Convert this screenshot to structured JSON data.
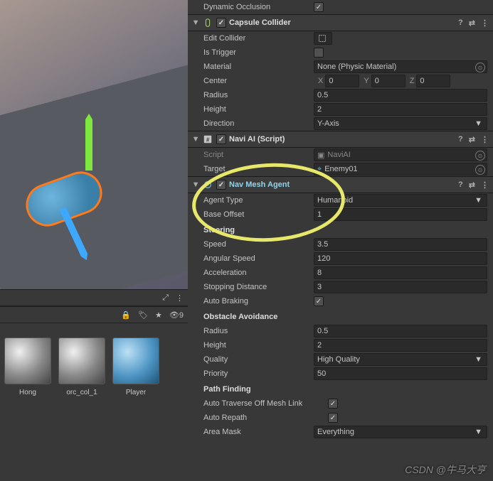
{
  "viewport": {
    "materials": [
      {
        "label": "Hong",
        "variant": "grey"
      },
      {
        "label": "orc_col_1",
        "variant": "grey"
      },
      {
        "label": "Player",
        "variant": "blue"
      }
    ],
    "visibility_count": "9"
  },
  "inspector": {
    "dyn_occlusion": {
      "label": "Dynamic Occlusion"
    },
    "capsule_collider": {
      "title": "Capsule Collider",
      "edit_collider": "Edit Collider",
      "is_trigger": "Is Trigger",
      "material": {
        "label": "Material",
        "value": "None (Physic Material)"
      },
      "center": {
        "label": "Center",
        "x": "0",
        "y": "0",
        "z": "0"
      },
      "radius": {
        "label": "Radius",
        "value": "0.5"
      },
      "height": {
        "label": "Height",
        "value": "2"
      },
      "direction": {
        "label": "Direction",
        "value": "Y-Axis"
      }
    },
    "navi_ai": {
      "title": "Navi AI (Script)",
      "script": {
        "label": "Script",
        "value": "NaviAI"
      },
      "target": {
        "label": "Target",
        "value": "Enemy01"
      }
    },
    "nav_mesh_agent": {
      "title": "Nav Mesh Agent",
      "agent_type": {
        "label": "Agent Type",
        "value": "Humanoid"
      },
      "base_offset": {
        "label": "Base Offset",
        "value": "1"
      },
      "steering": {
        "header": "Steering",
        "speed": {
          "label": "Speed",
          "value": "3.5"
        },
        "angular_speed": {
          "label": "Angular Speed",
          "value": "120"
        },
        "acceleration": {
          "label": "Acceleration",
          "value": "8"
        },
        "stopping_distance": {
          "label": "Stopping Distance",
          "value": "3"
        },
        "auto_braking": {
          "label": "Auto Braking"
        }
      },
      "obstacle": {
        "header": "Obstacle Avoidance",
        "radius": {
          "label": "Radius",
          "value": "0.5"
        },
        "height": {
          "label": "Height",
          "value": "2"
        },
        "quality": {
          "label": "Quality",
          "value": "High Quality"
        },
        "priority": {
          "label": "Priority",
          "value": "50"
        }
      },
      "pathfinding": {
        "header": "Path Finding",
        "traverse": {
          "label": "Auto Traverse Off Mesh Link"
        },
        "repath": {
          "label": "Auto Repath"
        },
        "area_mask": {
          "label": "Area Mask",
          "value": "Everything"
        }
      }
    }
  },
  "watermark": "CSDN @牛马大亨"
}
